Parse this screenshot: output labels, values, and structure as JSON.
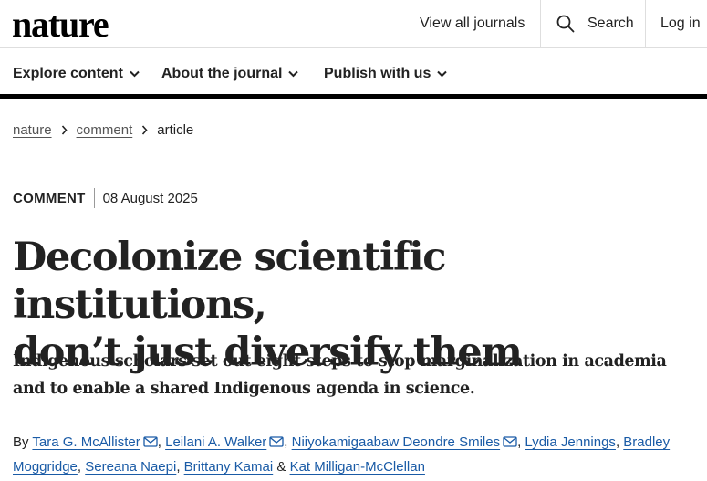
{
  "header": {
    "logo": "nature",
    "view_all_journals": "View all journals",
    "search_label": "Search",
    "login_label": "Log in"
  },
  "nav": {
    "items": [
      {
        "label": "Explore content"
      },
      {
        "label": "About the journal"
      },
      {
        "label": "Publish with us"
      }
    ]
  },
  "breadcrumb": {
    "items": [
      "nature",
      "comment",
      "article"
    ]
  },
  "article": {
    "type": "COMMENT",
    "date": "08 August 2025",
    "title_line1": "Decolonize scientific institutions,",
    "title_line2": "don’t just diversify them",
    "standfirst": "Indigenous scholars set out eight steps to stop marginalization in academia and to enable a shared Indigenous agenda in science.",
    "by_label": "By",
    "authors": [
      "Tara G. McAllister",
      "Leilani A. Walker",
      "Niiyokamigaabaw Deondre Smiles",
      "Lydia Jennings",
      "Bradley Moggridge",
      "Sereana Naepi",
      "Brittany Kamai",
      "Kat Milligan-McClellan"
    ],
    "ampersand": "&"
  },
  "colors": {
    "link_blue": "#1a5ba6",
    "text": "#222222",
    "nav_rule": "#000000"
  }
}
